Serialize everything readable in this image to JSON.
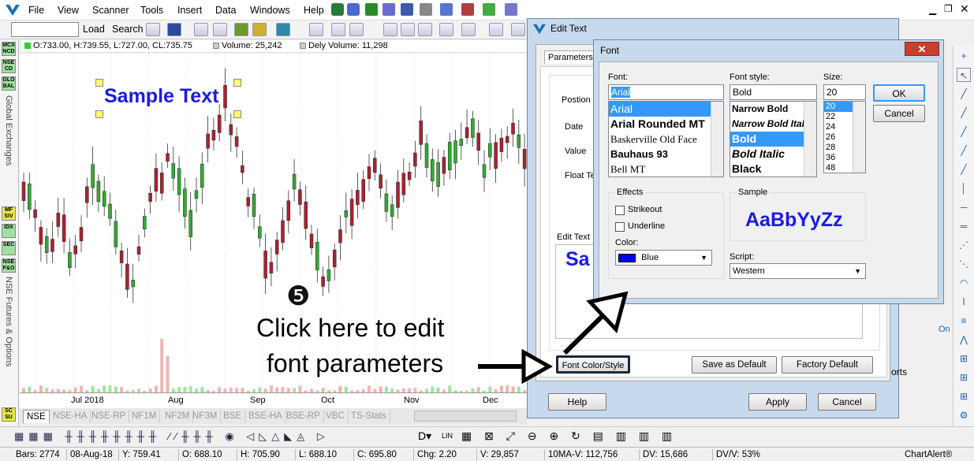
{
  "menu": {
    "items": [
      "File",
      "View",
      "Scanner",
      "Tools",
      "Insert",
      "Data",
      "Windows",
      "Help"
    ]
  },
  "toolbar": {
    "load_label": "Load",
    "search_label": "Search"
  },
  "infobar": {
    "ohlc": "O:733.00, H:739.55, L:727.00, CL:735.75",
    "volume": "Volume: 25,242",
    "dely_volume": "Dely Volume: 11,298"
  },
  "left_panel": {
    "buttons": [
      "MCX NCD",
      "NSE CD",
      "GLO BAL",
      "MF SIV",
      "IDX",
      "SEC",
      "NSE F&O"
    ],
    "global_exchanges": "Global Exchanges",
    "nse_fo": "NSE Futures & Options",
    "scsu": "SC SU"
  },
  "chart": {
    "sample_text": "Sample Text",
    "step_number": "❺",
    "instruction_line1": "Click here to edit",
    "instruction_line2": "font parameters",
    "x_labels": [
      "Jul 2018",
      "Aug",
      "Sep",
      "Oct",
      "Nov",
      "Dec"
    ]
  },
  "tabs": [
    "NSE",
    "NSE-HA",
    "NSE-RP",
    "NF1M",
    "NF2M",
    "NF3M",
    "BSE",
    "BSE-HA",
    "BSE-RP",
    "VBC",
    "TS-Stats"
  ],
  "status": {
    "bars": "Bars: 2774",
    "date": "08-Aug-18",
    "y": "Y: 759.41",
    "o": "O: 688.10",
    "h": "H: 705.90",
    "l": "L: 688.10",
    "c": "C: 695.80",
    "chg": "Chg: 2.20",
    "v": "V: 29,857",
    "mav": "10MA-V: 112,756",
    "dv": "DV: 15,686",
    "dvv": "DV/V: 53%",
    "brand": "ChartAlert®"
  },
  "edit_text_dialog": {
    "title": "Edit Text",
    "tab_parameters": "Parameters",
    "position_label": "Postion o",
    "date_label": "Date",
    "value_label": "Value",
    "float_label": "Float Te",
    "edit_text_label": "Edit Text",
    "edit_text_preview": "Sa",
    "font_color_style": "Font Color/Style",
    "save_default": "Save as Default",
    "factory_default": "Factory Default",
    "help": "Help",
    "apply": "Apply",
    "cancel": "Cancel",
    "side_ports": "orts",
    "side_on": "On"
  },
  "font_dialog": {
    "title": "Font",
    "font_label": "Font:",
    "font_value": "Arial",
    "fonts": [
      "Arial",
      "Arial Rounded MT",
      "Baskerville Old Face",
      "Bauhaus 93",
      "Bell MT"
    ],
    "style_label": "Font style:",
    "style_value": "Bold",
    "styles": [
      "Narrow Bold",
      "Narrow Bold Italic",
      "Bold",
      "Bold Italic",
      "Black"
    ],
    "size_label": "Size:",
    "size_value": "20",
    "sizes": [
      "20",
      "22",
      "24",
      "26",
      "28",
      "36",
      "48"
    ],
    "ok": "OK",
    "cancel": "Cancel",
    "effects_label": "Effects",
    "strikeout": "Strikeout",
    "underline": "Underline",
    "color_label": "Color:",
    "color_value": "Blue",
    "sample_label": "Sample",
    "sample_text": "AaBbYyZz",
    "script_label": "Script:",
    "script_value": "Western"
  },
  "colors": {
    "accent": "#1a1aff",
    "sample_blue": "#1a1ae6",
    "candle_green": "#33aa33",
    "candle_red": "#aa2233"
  }
}
